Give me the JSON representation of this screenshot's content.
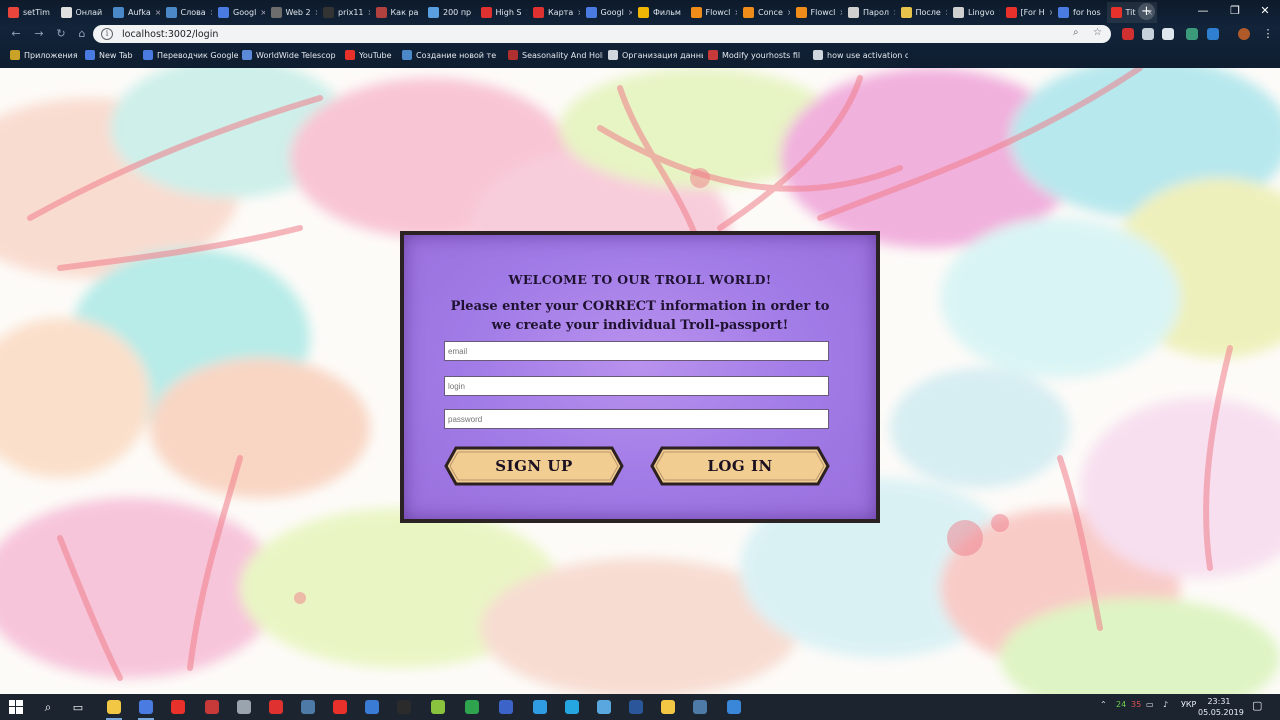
{
  "browser": {
    "tabs": [
      {
        "label": "setTim",
        "color": "#e8453c"
      },
      {
        "label": "Онлай",
        "color": "#e0e0e0"
      },
      {
        "label": "Aufka",
        "color": "#4a88c8"
      },
      {
        "label": "Слова",
        "color": "#4a88c8"
      },
      {
        "label": "Googl",
        "color": "#4a7be0"
      },
      {
        "label": "Web 2",
        "color": "#6d6d6d"
      },
      {
        "label": "prix11",
        "color": "#333333"
      },
      {
        "label": "Как ра",
        "color": "#b0413e"
      },
      {
        "label": "200 пр",
        "color": "#5aa0e0"
      },
      {
        "label": "High S",
        "color": "#e03131"
      },
      {
        "label": "Карта",
        "color": "#e03131"
      },
      {
        "label": "Googl",
        "color": "#4a7be0"
      },
      {
        "label": "Фильм",
        "color": "#f2b705"
      },
      {
        "label": "Flowcl",
        "color": "#f08c1a"
      },
      {
        "label": "Conce",
        "color": "#f08c1a"
      },
      {
        "label": "Flowcl",
        "color": "#f08c1a"
      },
      {
        "label": "Парол",
        "color": "#d0d0d0"
      },
      {
        "label": "После",
        "color": "#e6c34a"
      },
      {
        "label": "Lingvo",
        "color": "#d0d0d0"
      },
      {
        "label": "[For H",
        "color": "#e8312b"
      },
      {
        "label": "for hos",
        "color": "#4a7be0"
      },
      {
        "label": "Tit",
        "color": "#e8312b"
      }
    ],
    "url": "localhost:3002/login",
    "bookmarks": [
      {
        "label": "Приложения",
        "color": "#c9a227"
      },
      {
        "label": "New Tab",
        "color": "#4a7be0"
      },
      {
        "label": "Переводчик Google",
        "color": "#4a7be0"
      },
      {
        "label": "WorldWide Telescop",
        "color": "#5a8ad8"
      },
      {
        "label": "YouTube",
        "color": "#e8312b"
      },
      {
        "label": "Создание новой те",
        "color": "#4a88c8"
      },
      {
        "label": "Seasonality And Holi",
        "color": "#b03030"
      },
      {
        "label": "Организация данны",
        "color": "#cfd6dd"
      },
      {
        "label": "Modify yourhosts fil",
        "color": "#c83a3a"
      },
      {
        "label": "how use activation co",
        "color": "#cfd6dd"
      }
    ]
  },
  "page": {
    "welcome": "WELCOME TO OUR TROLL WORLD!",
    "intro_line1": "Please enter your CORRECT information in order to",
    "intro_line2": "we create your individual Troll-passport!",
    "email_placeholder": "email",
    "login_placeholder": "login",
    "password_placeholder": "password",
    "signup_label": "SIGN UP",
    "login_label": "LOG IN"
  },
  "taskbar": {
    "apps": [
      {
        "name": "explorer",
        "color": "#f2c744"
      },
      {
        "name": "chrome",
        "color": "#4a7be0"
      },
      {
        "name": "yandex",
        "color": "#e8312b"
      },
      {
        "name": "app-red",
        "color": "#c83a3a"
      },
      {
        "name": "app-gray",
        "color": "#9aa4ae"
      },
      {
        "name": "app-red2",
        "color": "#e03131"
      },
      {
        "name": "steam",
        "color": "#4e7aa8"
      },
      {
        "name": "opera",
        "color": "#e8312b"
      },
      {
        "name": "app-dark",
        "color": "#3a7bd5"
      },
      {
        "name": "epic",
        "color": "#2b2b2b"
      },
      {
        "name": "app-green",
        "color": "#8ac43f"
      },
      {
        "name": "app-green2",
        "color": "#2ea44f"
      },
      {
        "name": "app-blue",
        "color": "#3c64c8"
      },
      {
        "name": "app-blue2",
        "color": "#2f9be0"
      },
      {
        "name": "app-cyan",
        "color": "#26a6e0"
      },
      {
        "name": "app-skype",
        "color": "#5aa7e0"
      },
      {
        "name": "word",
        "color": "#2b579a"
      },
      {
        "name": "notes",
        "color": "#f2c744"
      },
      {
        "name": "steam2",
        "color": "#4e7aa8"
      },
      {
        "name": "vs",
        "color": "#3a86d8"
      }
    ],
    "tray_lang": "УКР",
    "time": "23:31",
    "date": "05.05.2019",
    "tray_num1": "24",
    "tray_num2": "35"
  }
}
